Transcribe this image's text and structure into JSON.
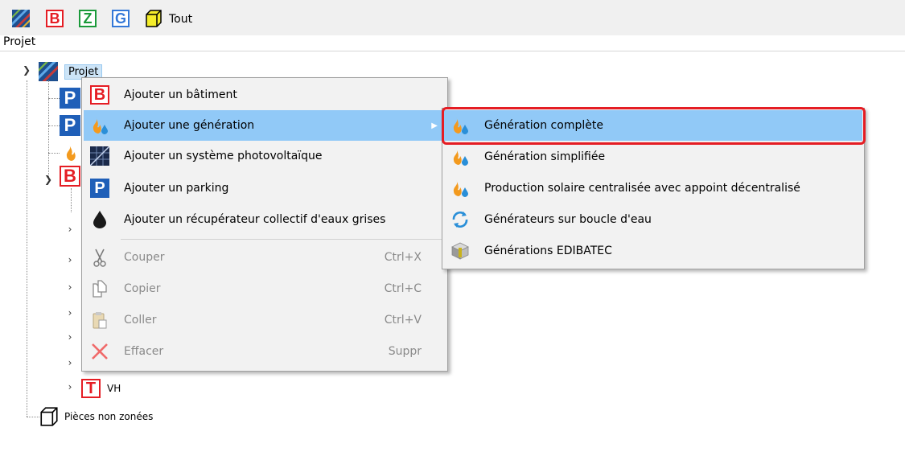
{
  "toolbar": {
    "b_letter": "B",
    "z_letter": "Z",
    "g_letter": "G",
    "label": "Tout"
  },
  "panel": {
    "title": "Projet"
  },
  "tree": {
    "root_label": "Projet",
    "p1_letter": "P",
    "p2_letter": "P",
    "b_letter": "B",
    "t_letter": "T",
    "vh_label": "VH",
    "unzoned_label": "Pièces non zonées"
  },
  "context_menu": {
    "items": [
      {
        "label": "Ajouter un bâtiment",
        "icon_letter": "B"
      },
      {
        "label": "Ajouter une génération"
      },
      {
        "label": "Ajouter un système photovoltaïque"
      },
      {
        "label": "Ajouter un parking",
        "icon_letter": "P"
      },
      {
        "label": "Ajouter un récupérateur collectif d'eaux grises"
      },
      {
        "label": "Couper",
        "shortcut": "Ctrl+X"
      },
      {
        "label": "Copier",
        "shortcut": "Ctrl+C"
      },
      {
        "label": "Coller",
        "shortcut": "Ctrl+V"
      },
      {
        "label": "Effacer",
        "shortcut": "Suppr"
      }
    ]
  },
  "submenu": {
    "items": [
      {
        "label": "Génération complète"
      },
      {
        "label": "Génération simplifiée"
      },
      {
        "label": "Production solaire centralisée avec appoint décentralisé"
      },
      {
        "label": "Générateurs sur boucle d'eau"
      },
      {
        "label": "Générations EDIBATEC"
      }
    ]
  },
  "colors": {
    "highlight": "#91c9f7",
    "red": "#e51d24",
    "blue_letter": "#1565c0",
    "green_letter": "#1a9a3a"
  }
}
